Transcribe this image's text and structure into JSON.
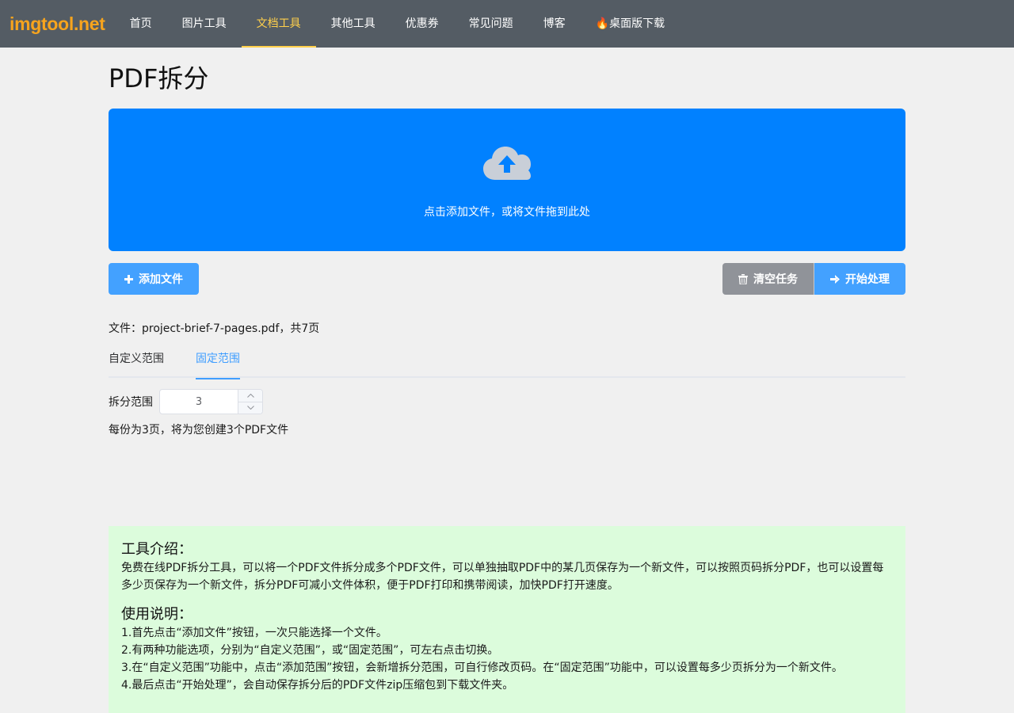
{
  "nav": {
    "logo": "imgtool.net",
    "items": [
      {
        "label": "首页",
        "active": false
      },
      {
        "label": "图片工具",
        "active": false
      },
      {
        "label": "文档工具",
        "active": true
      },
      {
        "label": "其他工具",
        "active": false
      },
      {
        "label": "优惠券",
        "active": false
      },
      {
        "label": "常见问题",
        "active": false
      },
      {
        "label": "博客",
        "active": false
      },
      {
        "label": "🔥桌面版下载",
        "active": false
      }
    ]
  },
  "page": {
    "title": "PDF拆分"
  },
  "dropzone": {
    "text": "点击添加文件，或将文件拖到此处",
    "icon": "cloud-upload-icon"
  },
  "actions": {
    "add_file": "添加文件",
    "clear_tasks": "清空任务",
    "start": "开始处理"
  },
  "file_info": "文件：project-brief-7-pages.pdf，共7页",
  "tabs": [
    {
      "label": "自定义范围",
      "active": false
    },
    {
      "label": "固定范围",
      "active": true
    }
  ],
  "range": {
    "label": "拆分范围",
    "value": "3",
    "description": "每份为3页，将为您创建3个PDF文件"
  },
  "intro": {
    "title": "工具介绍：",
    "text": "免费在线PDF拆分工具，可以将一个PDF文件拆分成多个PDF文件，可以单独抽取PDF中的某几页保存为一个新文件，可以按照页码拆分PDF，也可以设置每多少页保存为一个新文件，拆分PDF可减小文件体积，便于PDF打印和携带阅读，加快PDF打开速度。",
    "usage_title": "使用说明：",
    "steps": [
      "1.首先点击“添加文件”按钮，一次只能选择一个文件。",
      "2.有两种功能选项，分别为“自定义范围”，或“固定范围”，可左右点击切换。",
      "3.在“自定义范围”功能中，点击“添加范围”按钮，会新增拆分范围，可自行修改页码。在“固定范围”功能中，可以设置每多少页拆分为一个新文件。",
      "4.最后点击“开始处理”，会自动保存拆分后的PDF文件zip压缩包到下载文件夹。"
    ]
  },
  "colors": {
    "nav_bg": "#545c64",
    "nav_active": "#ffd04b",
    "logo": "#f7a41d",
    "dropzone_bg": "#0181ff",
    "button_blue": "#43a1ff",
    "button_gray": "#909399",
    "intro_bg": "#dcfcdc"
  }
}
